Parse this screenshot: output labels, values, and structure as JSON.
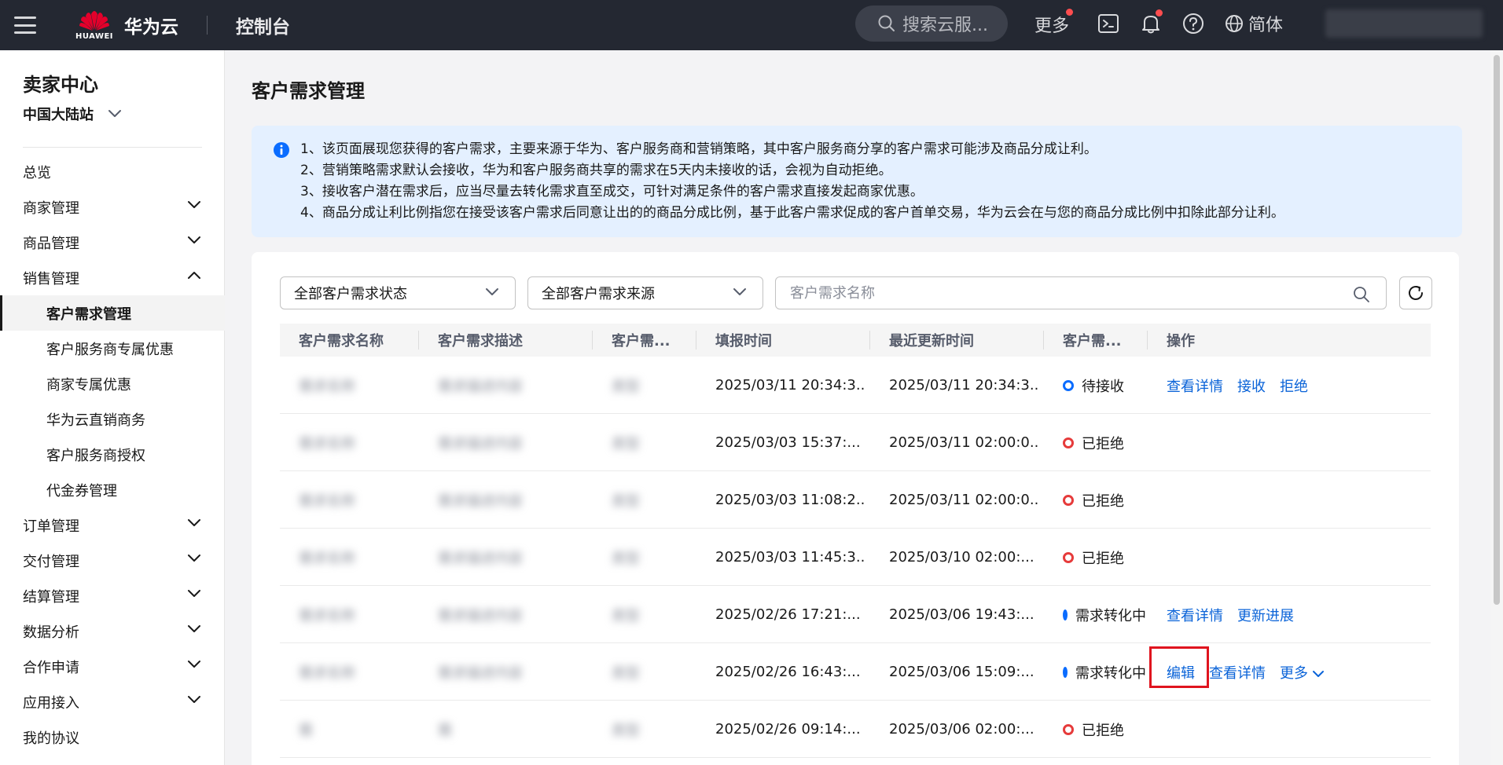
{
  "topbar": {
    "logo_text": "HUAWEI",
    "brand": "华为云",
    "console": "控制台",
    "search_placeholder": "搜索云服...",
    "more": "更多",
    "language": "简体"
  },
  "sidebar": {
    "title": "卖家中心",
    "region": "中国大陆站",
    "items": [
      {
        "label": "总览",
        "level": 1,
        "chevron": "none"
      },
      {
        "label": "商家管理",
        "level": 1,
        "chevron": "down"
      },
      {
        "label": "商品管理",
        "level": 1,
        "chevron": "down"
      },
      {
        "label": "销售管理",
        "level": 1,
        "chevron": "up"
      },
      {
        "label": "客户需求管理",
        "level": 2,
        "active": true
      },
      {
        "label": "客户服务商专属优惠",
        "level": 2
      },
      {
        "label": "商家专属优惠",
        "level": 2
      },
      {
        "label": "华为云直销商务",
        "level": 2
      },
      {
        "label": "客户服务商授权",
        "level": 2
      },
      {
        "label": "代金券管理",
        "level": 2
      },
      {
        "label": "订单管理",
        "level": 1,
        "chevron": "down"
      },
      {
        "label": "交付管理",
        "level": 1,
        "chevron": "down"
      },
      {
        "label": "结算管理",
        "level": 1,
        "chevron": "down"
      },
      {
        "label": "数据分析",
        "level": 1,
        "chevron": "down"
      },
      {
        "label": "合作申请",
        "level": 1,
        "chevron": "down"
      },
      {
        "label": "应用接入",
        "level": 1,
        "chevron": "down"
      },
      {
        "label": "我的协议",
        "level": 1,
        "chevron": "none"
      }
    ]
  },
  "main": {
    "page_title": "客户需求管理",
    "notice_lines": [
      "1、该页面展现您获得的客户需求，主要来源于华为、客户服务商和营销策略，其中客户服务商分享的客户需求可能涉及商品分成让利。",
      "2、营销策略需求默认会接收，华为和客户服务商共享的需求在5天内未接收的话，会视为自动拒绝。",
      "3、接收客户潜在需求后，应当尽量去转化需求直至成交，可针对满足条件的客户需求直接发起商家优惠。",
      "4、商品分成让利比例指您在接受该客户需求后同意让出的的商品分成比例，基于此客户需求促成的客户首单交易，华为云会在与您的商品分成比例中扣除此部分让利。"
    ],
    "filters": {
      "status_select": "全部客户需求状态",
      "source_select": "全部客户需求来源",
      "search_placeholder": "客户需求名称"
    },
    "table": {
      "columns": [
        "客户需求名称",
        "客户需求描述",
        "客户需...",
        "填报时间",
        "最近更新时间",
        "客户需...",
        "操作"
      ],
      "rows": [
        {
          "name": "需求名称",
          "desc": "需求描述内容",
          "type": "类型",
          "filed": "2025/03/11 20:34:3...",
          "updated": "2025/03/11 20:34:3...",
          "status": "待接收",
          "status_color": "blue",
          "ops": [
            "查看详情",
            "接收",
            "拒绝"
          ]
        },
        {
          "name": "需求名称",
          "desc": "需求描述内容",
          "type": "类型",
          "filed": "2025/03/03 15:37:...",
          "updated": "2025/03/11 02:00:0...",
          "status": "已拒绝",
          "status_color": "red",
          "ops": []
        },
        {
          "name": "需求名称",
          "desc": "需求描述内容",
          "type": "类型",
          "filed": "2025/03/03 11:08:2...",
          "updated": "2025/03/11 02:00:0...",
          "status": "已拒绝",
          "status_color": "red",
          "ops": []
        },
        {
          "name": "需求名称",
          "desc": "需求描述内容",
          "type": "类型",
          "filed": "2025/03/03 11:45:3...",
          "updated": "2025/03/10 02:00:...",
          "status": "已拒绝",
          "status_color": "red",
          "ops": []
        },
        {
          "name": "需求名称",
          "desc": "需求描述内容",
          "type": "类型",
          "filed": "2025/02/26 17:21:...",
          "updated": "2025/03/06 19:43:...",
          "status": "需求转化中",
          "status_color": "blue",
          "ops": [
            "查看详情",
            "更新进展"
          ]
        },
        {
          "name": "需求名称",
          "desc": "需求描述内容",
          "type": "类型",
          "filed": "2025/02/26 16:43:...",
          "updated": "2025/03/06 15:09:...",
          "status": "需求转化中",
          "status_color": "blue",
          "ops": [
            "编辑",
            "查看详情",
            "更多"
          ]
        },
        {
          "name": "需",
          "desc": "需",
          "type": "类型",
          "filed": "2025/02/26 09:14:...",
          "updated": "2025/03/06 02:00:...",
          "status": "已拒绝",
          "status_color": "red",
          "ops": []
        }
      ]
    }
  },
  "colors": {
    "topbar_bg": "#242832",
    "link": "#0a63d8",
    "notice_bg": "#e4f0ff",
    "status_blue": "#0a6cff",
    "status_red": "#e63b3b",
    "highlight": "#e0141e"
  }
}
